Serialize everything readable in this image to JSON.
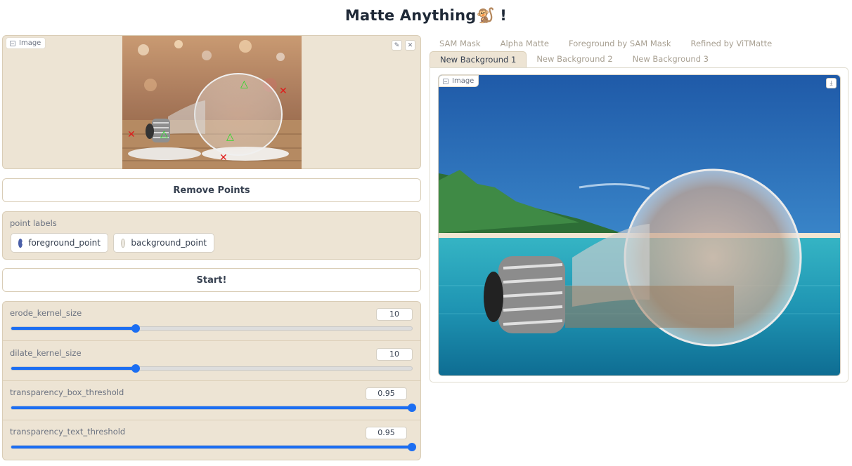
{
  "app": {
    "title": "Matte Anything🐒 !"
  },
  "input_image": {
    "badge": "Image",
    "edit_icon": "pencil-icon",
    "close_icon": "close-icon",
    "markers": {
      "foreground_symbol": "△",
      "background_symbol": "✕",
      "foreground_color": "#22dd22",
      "background_color": "#e01b1b"
    }
  },
  "buttons": {
    "remove_points": "Remove Points",
    "start": "Start!"
  },
  "point_labels": {
    "label": "point labels",
    "options": [
      "foreground_point",
      "background_point"
    ],
    "selected": "foreground_point"
  },
  "sliders": [
    {
      "label": "erode_kernel_size",
      "value": "10",
      "fraction": 0.31
    },
    {
      "label": "dilate_kernel_size",
      "value": "10",
      "fraction": 0.31
    },
    {
      "label": "transparency_box_threshold",
      "value": "0.95",
      "fraction": 1.0
    },
    {
      "label": "transparency_text_threshold",
      "value": "0.95",
      "fraction": 1.0
    }
  ],
  "output": {
    "tabs_row1": [
      "SAM Mask",
      "Alpha Matte",
      "Foreground by SAM Mask",
      "Refined by ViTMatte"
    ],
    "tabs_row2": [
      "New Background 1",
      "New Background 2",
      "New Background 3"
    ],
    "active_tab": "New Background 1",
    "badge": "Image",
    "download_icon": "download-icon"
  },
  "colors": {
    "accent": "#1c6ef2",
    "panel": "#ede4d4",
    "radio_selected": "#4a5fa8"
  }
}
